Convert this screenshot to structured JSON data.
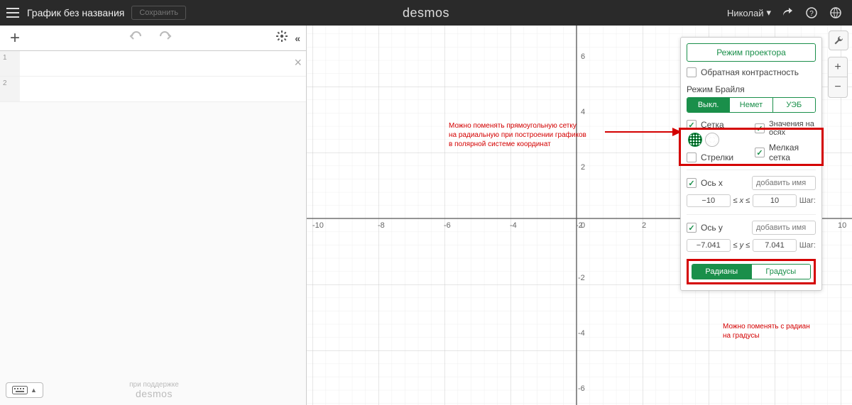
{
  "header": {
    "title": "График без названия",
    "save": "Сохранить",
    "logo": "desmos",
    "user": "Николай"
  },
  "settings": {
    "projector": "Режим проектора",
    "reverse_contrast": "Обратная контрастность",
    "braille_title": "Режим Брайля",
    "braille_off": "Выкл.",
    "braille_nemeth": "Немет",
    "braille_ueb": "УЭБ",
    "grid_label": "Сетка",
    "axis_numbers": "Значения на осях",
    "minor_grid": "Мелкая сетка",
    "arrows": "Стрелки",
    "x_axis": "Ось x",
    "y_axis": "Ось y",
    "add_name_placeholder": "добавить имя",
    "x_min": "−10",
    "x_rel": "≤ x ≤",
    "x_max": "10",
    "y_min": "−7.041",
    "y_rel": "≤ y ≤",
    "y_max": "7.041",
    "step": "Шаг:",
    "radians": "Радианы",
    "degrees": "Градусы"
  },
  "annotations": {
    "grid_note_l1": "Можно поменять прямоугольную сетку",
    "grid_note_l2": "на радиальную при построении графиков",
    "grid_note_l3": "в полярной системе координат",
    "units_note_l1": "Можно поменять с радиан",
    "units_note_l2": "на градусы"
  },
  "axes": {
    "x_ticks": [
      "-10",
      "-8",
      "-6",
      "-4",
      "-2",
      "0",
      "2",
      "10"
    ],
    "y_ticks": [
      "6",
      "4",
      "2",
      "-2",
      "-4",
      "-6"
    ]
  },
  "footer": {
    "powered": "при поддержке",
    "logo": "desmos"
  },
  "expr": {
    "rows": [
      "1",
      "2"
    ]
  }
}
